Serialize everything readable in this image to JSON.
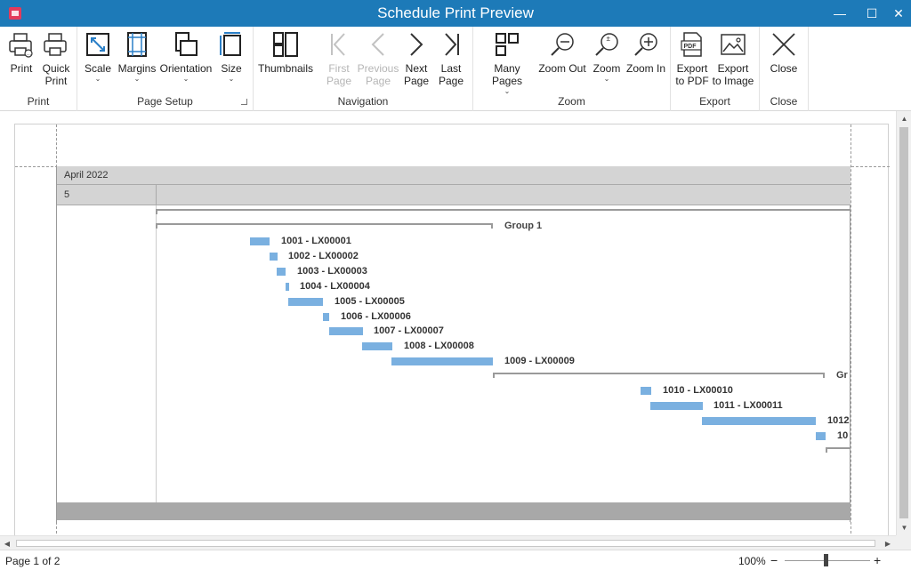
{
  "window": {
    "title": "Schedule Print Preview",
    "controls": {
      "minimize": "—",
      "maximize": "☐",
      "close": "✕"
    }
  },
  "ribbon": {
    "groups": [
      {
        "label": "Print",
        "buttons": [
          {
            "label": "Print",
            "icon": "printer-icon"
          },
          {
            "label": "Quick\nPrint",
            "icon": "quick-print-icon"
          }
        ]
      },
      {
        "label": "Page Setup",
        "buttons": [
          {
            "label": "Scale",
            "icon": "scale-icon",
            "dropdown": true
          },
          {
            "label": "Margins",
            "icon": "margins-icon",
            "dropdown": true
          },
          {
            "label": "Orientation",
            "icon": "orientation-icon",
            "dropdown": true
          },
          {
            "label": "Size",
            "icon": "page-size-icon",
            "dropdown": true
          }
        ]
      },
      {
        "label": "Navigation",
        "buttons": [
          {
            "label": "Thumbnails",
            "icon": "thumbnails-icon"
          },
          {
            "label": "First\nPage",
            "icon": "first-page-icon",
            "disabled": true
          },
          {
            "label": "Previous\nPage",
            "icon": "previous-page-icon",
            "disabled": true
          },
          {
            "label": "Next\nPage",
            "icon": "next-page-icon"
          },
          {
            "label": "Last\nPage",
            "icon": "last-page-icon"
          }
        ]
      },
      {
        "label": "Zoom",
        "buttons": [
          {
            "label": "Many Pages",
            "icon": "many-pages-icon",
            "dropdown": true
          },
          {
            "label": "Zoom Out",
            "icon": "zoom-out-icon"
          },
          {
            "label": "Zoom",
            "icon": "zoom-icon",
            "dropdown": true
          },
          {
            "label": "Zoom In",
            "icon": "zoom-in-icon"
          }
        ]
      },
      {
        "label": "Export",
        "buttons": [
          {
            "label": "Export\nto PDF",
            "icon": "pdf-icon"
          },
          {
            "label": "Export\nto Image",
            "icon": "image-icon"
          }
        ]
      },
      {
        "label": "Close",
        "buttons": [
          {
            "label": "Close",
            "icon": "close-icon"
          }
        ]
      }
    ]
  },
  "schedule": {
    "month_header": "April 2022",
    "day_header": "5",
    "groups": [
      {
        "label": "Group 1"
      },
      {
        "label": "Gr"
      }
    ],
    "tasks": [
      {
        "label": "1001 - LX00001"
      },
      {
        "label": "1002 - LX00002"
      },
      {
        "label": "1003 - LX00003"
      },
      {
        "label": "1004 - LX00004"
      },
      {
        "label": "1005 - LX00005"
      },
      {
        "label": "1006 - LX00006"
      },
      {
        "label": "1007 - LX00007"
      },
      {
        "label": "1008 - LX00008"
      },
      {
        "label": "1009 - LX00009"
      },
      {
        "label": "1010 - LX00010"
      },
      {
        "label": "1011 - LX00011"
      },
      {
        "label": "1012"
      },
      {
        "label": "10"
      }
    ]
  },
  "statusbar": {
    "page_info": "Page 1 of 2",
    "zoom_value": "100%",
    "zoom_percent": 100,
    "zoom_minus": "−",
    "zoom_plus": "+"
  },
  "colors": {
    "titlebar": "#1d7ab8",
    "task_bar": "#7ab0e0",
    "header_band": "#d4d4d4",
    "footer_band": "#a8a8a8"
  }
}
